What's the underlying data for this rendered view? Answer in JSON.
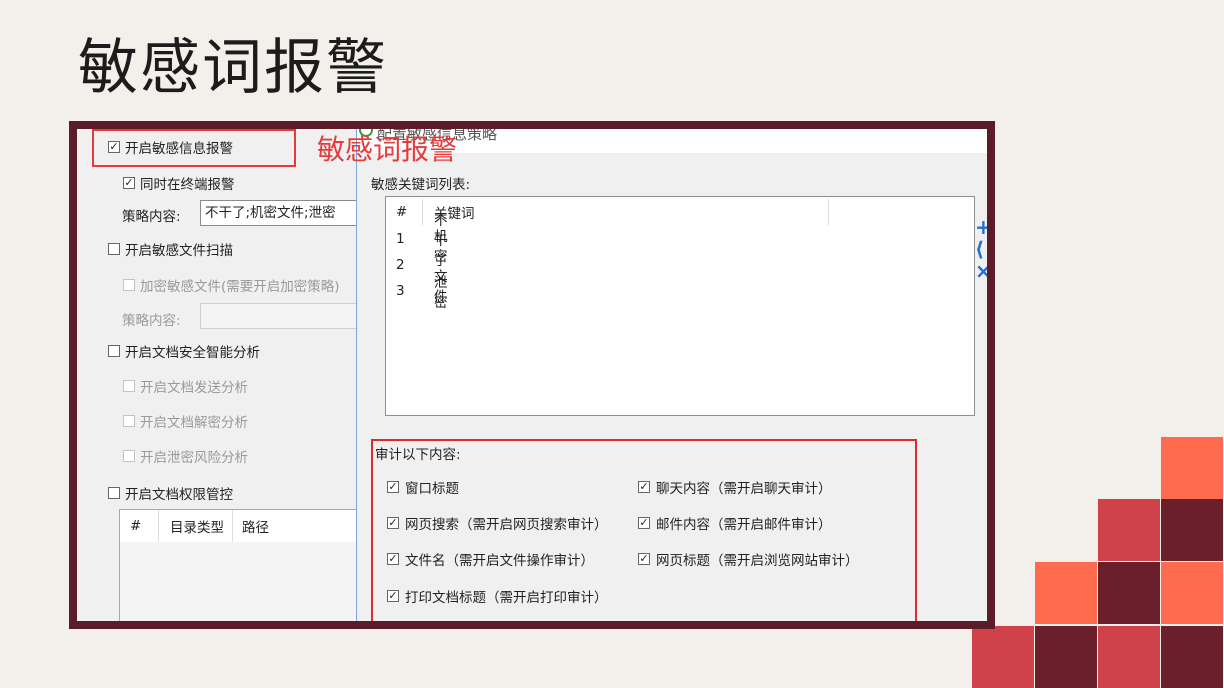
{
  "slide": {
    "title": "敏感词报警"
  },
  "annotation": {
    "label": "敏感词报警"
  },
  "left_panel": {
    "enable_sensitive_info_alarm": {
      "label": "开启敏感信息报警",
      "checked": true
    },
    "terminal_alarm": {
      "label": "同时在终端报警",
      "checked": true
    },
    "policy_content_label": "策略内容:",
    "policy_content_value": "不干了;机密文件;泄密",
    "enable_sensitive_file_scan": {
      "label": "开启敏感文件扫描",
      "checked": false
    },
    "encrypt_sensitive_file": {
      "label": "加密敏感文件(需要开启加密策略)",
      "checked": false
    },
    "policy_content_label_2": "策略内容:",
    "policy_content_value_2": "",
    "enable_doc_security_analysis": {
      "label": "开启文档安全智能分析",
      "checked": false
    },
    "doc_send_analysis": {
      "label": "开启文档发送分析",
      "checked": false
    },
    "doc_decrypt_analysis": {
      "label": "开启文档解密分析",
      "checked": false
    },
    "leak_risk_analysis": {
      "label": "开启泄密风险分析",
      "checked": false
    },
    "enable_doc_permission": {
      "label": "开启文档权限管控",
      "checked": false
    },
    "permission_table_headers": [
      "#",
      "目录类型",
      "路径"
    ]
  },
  "dialog": {
    "title": "配置敏感信息策略",
    "keyword_list_label": "敏感关键词列表:",
    "keyword_headers": [
      "#",
      "关键词"
    ],
    "keywords": [
      {
        "num": "1",
        "word": "不干了"
      },
      {
        "num": "2",
        "word": "机密文件"
      },
      {
        "num": "3",
        "word": "泄密"
      }
    ],
    "audit_label": "审计以下内容:",
    "audit_items": [
      {
        "label": "窗口标题",
        "checked": true
      },
      {
        "label": "聊天内容（需开启聊天审计）",
        "checked": true
      },
      {
        "label": "网页搜索（需开启网页搜索审计）",
        "checked": true
      },
      {
        "label": "邮件内容（需开启邮件审计）",
        "checked": true
      },
      {
        "label": "文件名（需开启文件操作审计）",
        "checked": true
      },
      {
        "label": "网页标题（需开启浏览网站审计）",
        "checked": true
      },
      {
        "label": "打印文档标题（需开启打印审计）",
        "checked": true
      }
    ]
  },
  "colors": {
    "frame": "#5a1d28",
    "annotation_red": "#e53b3b",
    "square_coral": "#ff6b4f",
    "square_red": "#d0424a",
    "square_maroon": "#6a1f2b"
  }
}
